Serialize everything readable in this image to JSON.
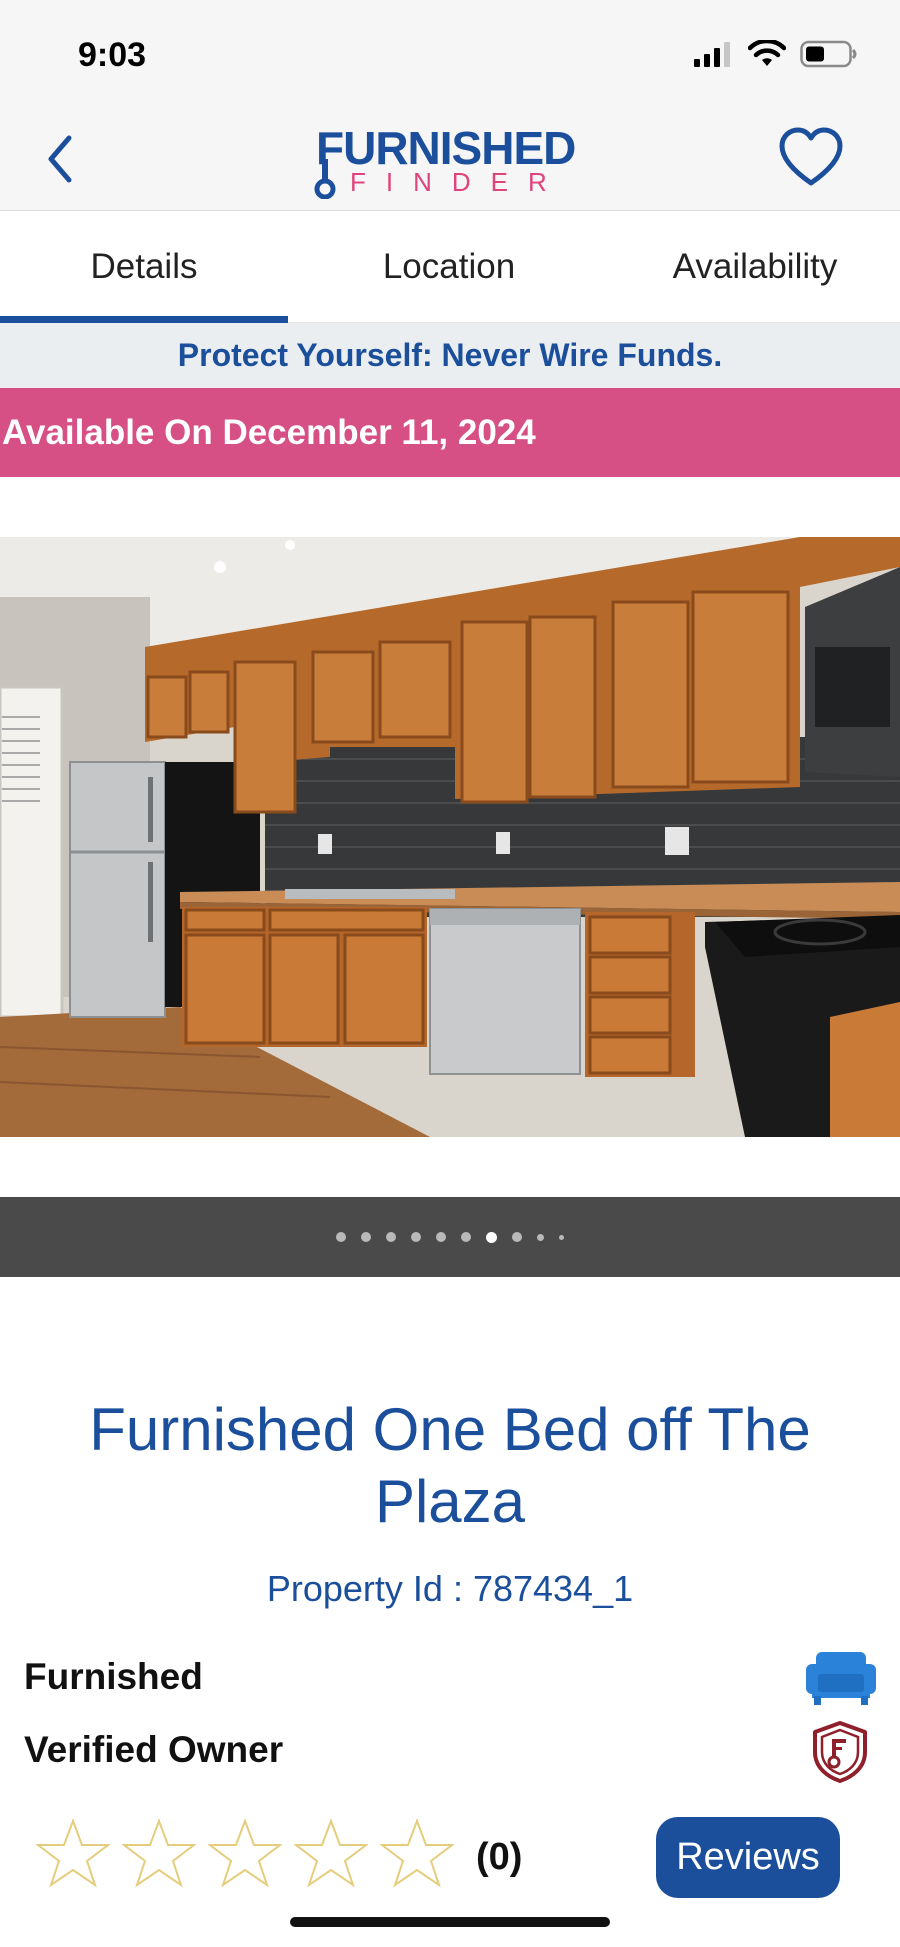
{
  "status_bar": {
    "time": "9:03"
  },
  "header": {
    "logo_top": "FURNISHED",
    "logo_bottom": "FINDER",
    "colors": {
      "brand_blue": "#1b4f9c",
      "brand_pink": "#e0447c"
    }
  },
  "tabs": [
    {
      "label": "Details",
      "active": true
    },
    {
      "label": "Location",
      "active": false
    },
    {
      "label": "Availability",
      "active": false
    }
  ],
  "warning_banner": "Protect Yourself: Never Wire Funds.",
  "availability_banner": "Available On December 11, 2024",
  "photo": {
    "description_icon": "kitchen-photo",
    "carousel": {
      "total_dots": 10,
      "active_index": 6
    }
  },
  "listing": {
    "title": "Furnished One Bed off The Plaza",
    "property_id": "Property Id : 787434_1"
  },
  "features": [
    {
      "label": "Furnished",
      "icon": "sofa-icon"
    },
    {
      "label": "Verified Owner",
      "icon": "verified-shield-icon"
    }
  ],
  "rating": {
    "stars_filled": 0,
    "stars_total": 5,
    "count": "(0)",
    "reviews_button": "Reviews"
  }
}
